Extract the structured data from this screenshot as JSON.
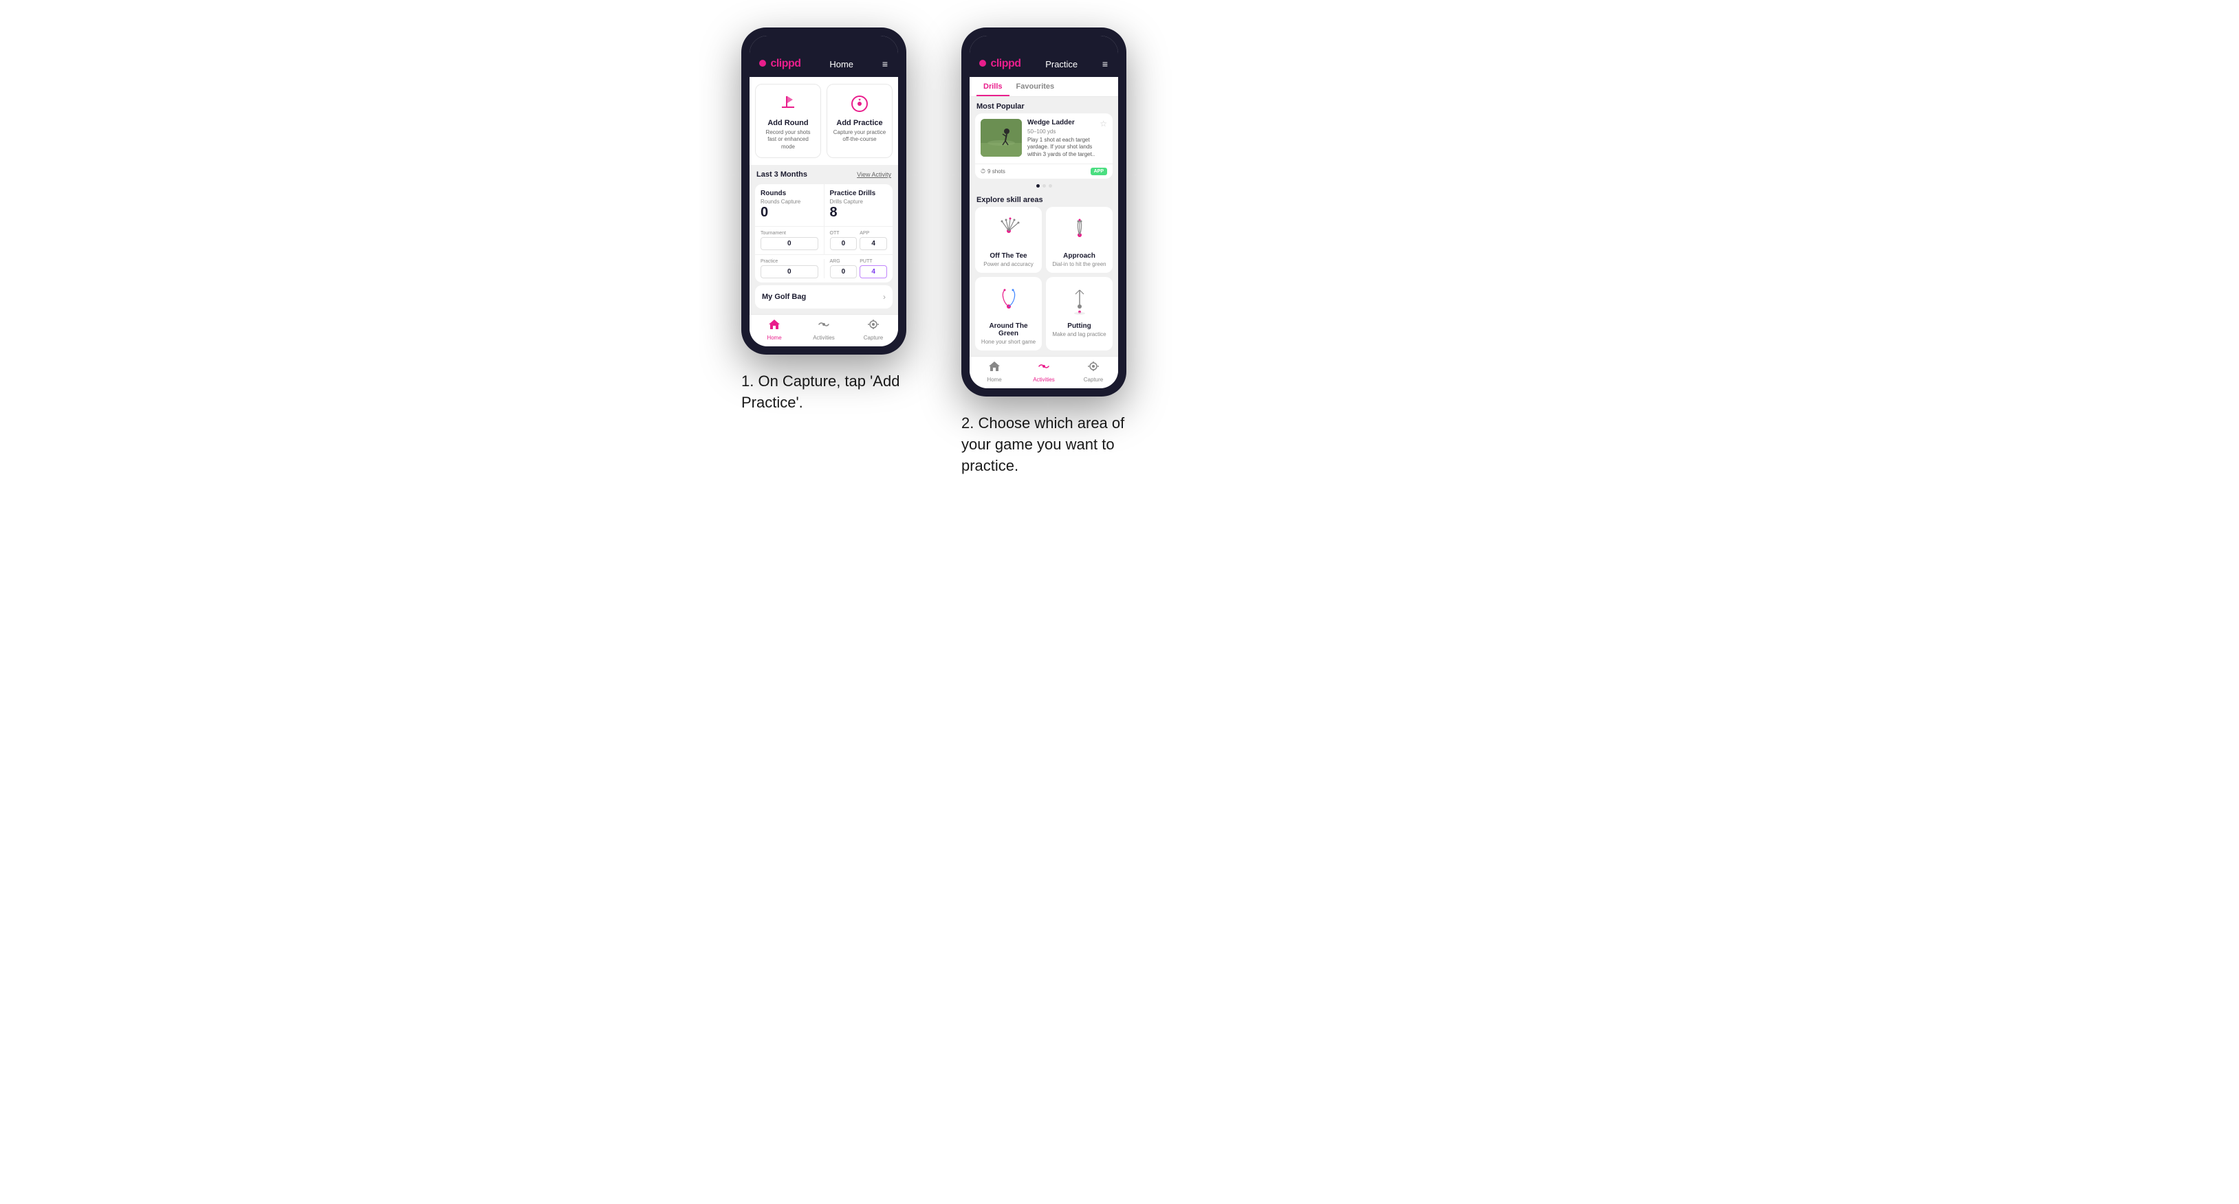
{
  "page": {
    "background": "#ffffff"
  },
  "phone1": {
    "logo": "clippd",
    "header_title": "Home",
    "menu_icon": "≡",
    "action_cards": [
      {
        "id": "add_round",
        "title": "Add Round",
        "description": "Record your shots fast or enhanced mode",
        "icon": "flag"
      },
      {
        "id": "add_practice",
        "title": "Add Practice",
        "description": "Capture your practice off-the-course",
        "icon": "target"
      }
    ],
    "stats_period": "Last 3 Months",
    "view_activity_label": "View Activity",
    "rounds_label": "Rounds",
    "practice_drills_label": "Practice Drills",
    "rounds_capture_label": "Rounds Capture",
    "rounds_value": "0",
    "drills_capture_label": "Drills Capture",
    "drills_value": "8",
    "tournament_label": "Tournament",
    "tournament_value": "0",
    "ott_label": "OTT",
    "ott_value": "0",
    "app_label": "APP",
    "app_value": "4",
    "practice_label": "Practice",
    "practice_value": "0",
    "arg_label": "ARG",
    "arg_value": "0",
    "putt_label": "PUTT",
    "putt_value": "4",
    "golf_bag_label": "My Golf Bag",
    "nav_items": [
      {
        "label": "Home",
        "active": true,
        "icon": "home"
      },
      {
        "label": "Activities",
        "active": false,
        "icon": "activities"
      },
      {
        "label": "Capture",
        "active": false,
        "icon": "capture"
      }
    ],
    "caption": "1. On Capture, tap 'Add Practice'."
  },
  "phone2": {
    "logo": "clippd",
    "header_title": "Practice",
    "menu_icon": "≡",
    "tabs": [
      {
        "label": "Drills",
        "active": true
      },
      {
        "label": "Favourites",
        "active": false
      }
    ],
    "most_popular_label": "Most Popular",
    "drill": {
      "title": "Wedge Ladder",
      "subtitle": "50–100 yds",
      "description": "Play 1 shot at each target yardage. If your shot lands within 3 yards of the target..",
      "shots": "9 shots",
      "badge": "APP"
    },
    "explore_label": "Explore skill areas",
    "skill_areas": [
      {
        "id": "off_the_tee",
        "title": "Off The Tee",
        "description": "Power and accuracy"
      },
      {
        "id": "approach",
        "title": "Approach",
        "description": "Dial-in to hit the green"
      },
      {
        "id": "around_the_green",
        "title": "Around The Green",
        "description": "Hone your short game"
      },
      {
        "id": "putting",
        "title": "Putting",
        "description": "Make and lag practice"
      }
    ],
    "nav_items": [
      {
        "label": "Home",
        "active": false,
        "icon": "home"
      },
      {
        "label": "Activities",
        "active": true,
        "icon": "activities"
      },
      {
        "label": "Capture",
        "active": false,
        "icon": "capture"
      }
    ],
    "caption": "2. Choose which area of your game you want to practice."
  }
}
